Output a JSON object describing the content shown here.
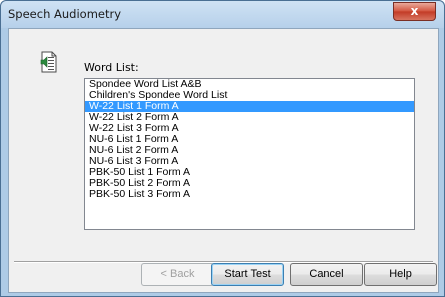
{
  "window": {
    "title": "Speech Audiometry",
    "close_label": "x"
  },
  "word_list": {
    "label": "Word List:",
    "items": [
      "Spondee Word List A&B",
      "Children's Spondee Word List",
      "W-22 List 1 Form A",
      "W-22 List 2 Form A",
      "W-22 List 3 Form A",
      "NU-6 List 1 Form A",
      "NU-6 List 2 Form A",
      "NU-6 List 3 Form A",
      "PBK-50 List 1 Form A",
      "PBK-50 List 2 Form A",
      "PBK-50 List 3 Form A"
    ],
    "selected_index": 2
  },
  "buttons": {
    "back": "< Back",
    "start_test": "Start Test",
    "cancel": "Cancel",
    "help": "Help"
  },
  "icons": {
    "dialog": "audio-document-icon",
    "close": "close-icon"
  },
  "colors": {
    "selection": "#3399ff",
    "close_button": "#c23a25"
  }
}
